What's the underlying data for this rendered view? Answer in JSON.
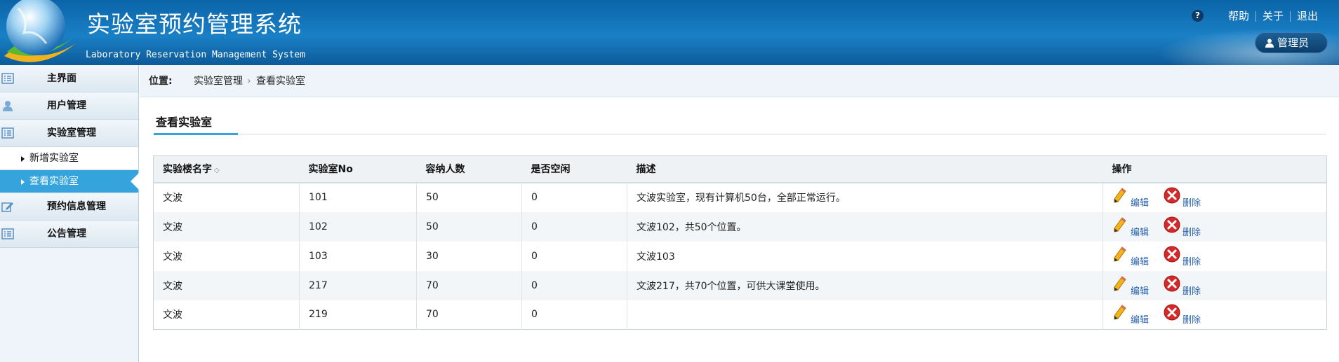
{
  "header": {
    "title": "实验室预约管理系统",
    "subtitle": "Laboratory Reservation Management System",
    "help_icon_text": "?",
    "links": [
      "帮助",
      "关于",
      "退出"
    ],
    "user_label": "管理员"
  },
  "sidebar": {
    "items": [
      {
        "label": "主界面",
        "icon": "list-icon"
      },
      {
        "label": "用户管理",
        "icon": "user-icon"
      },
      {
        "label": "实验室管理",
        "icon": "list-icon"
      },
      {
        "label": "预约信息管理",
        "icon": "edit-icon"
      },
      {
        "label": "公告管理",
        "icon": "list-icon"
      }
    ],
    "subitems": [
      {
        "label": "新增实验室",
        "active": false
      },
      {
        "label": "查看实验室",
        "active": true
      }
    ]
  },
  "breadcrumb": {
    "label": "位置:",
    "items": [
      "实验室管理",
      "查看实验室"
    ],
    "separator": "›"
  },
  "page": {
    "title": "查看实验室"
  },
  "table": {
    "columns": [
      "实验楼名字",
      "实验室No",
      "容纳人数",
      "是否空闲",
      "描述",
      "操作"
    ],
    "sort_indicator": "◇",
    "edit_label": "编辑",
    "delete_label": "删除",
    "rows": [
      {
        "building": "文波",
        "no": "101",
        "capacity": "50",
        "free": "0",
        "desc": "文波实验室，现有计算机50台，全部正常运行。"
      },
      {
        "building": "文波",
        "no": "102",
        "capacity": "50",
        "free": "0",
        "desc": "文波102，共50个位置。"
      },
      {
        "building": "文波",
        "no": "103",
        "capacity": "30",
        "free": "0",
        "desc": "文波103"
      },
      {
        "building": "文波",
        "no": "217",
        "capacity": "70",
        "free": "0",
        "desc": "文波217，共70个位置，可供大课堂使用。"
      },
      {
        "building": "文波",
        "no": "219",
        "capacity": "70",
        "free": "0",
        "desc": ""
      }
    ]
  },
  "colors": {
    "header_blue": "#1a80c6",
    "accent": "#35a3dc",
    "link": "#2a64b0",
    "delete_red": "#d42a2a"
  }
}
